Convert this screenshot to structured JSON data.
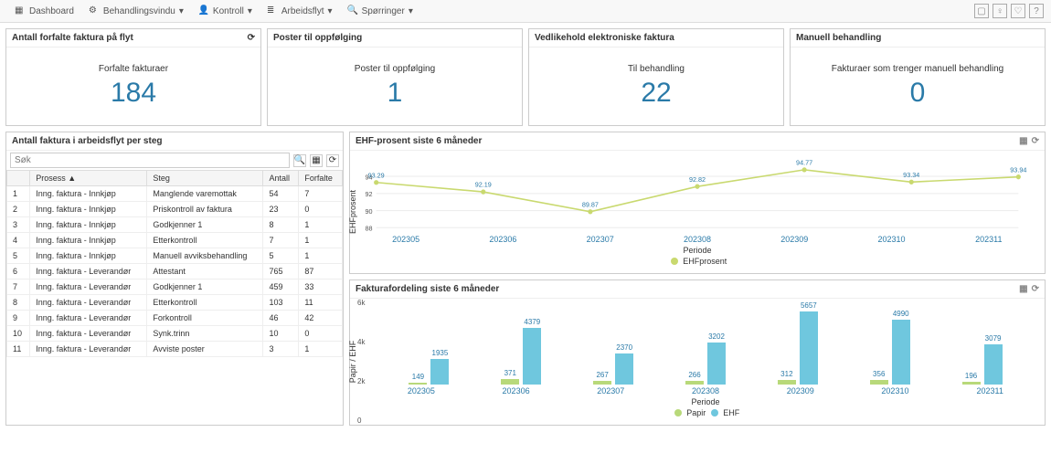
{
  "topbar": {
    "items": [
      {
        "label": "Dashboard",
        "icon": "grid"
      },
      {
        "label": "Behandlingsvindu",
        "icon": "gear",
        "dropdown": true
      },
      {
        "label": "Kontroll",
        "icon": "user",
        "dropdown": true
      },
      {
        "label": "Arbeidsflyt",
        "icon": "flow",
        "dropdown": true
      },
      {
        "label": "Spørringer",
        "icon": "search",
        "dropdown": true
      }
    ]
  },
  "kpis": [
    {
      "title": "Antall forfalte faktura på flyt",
      "label": "Forfalte fakturaer",
      "value": "184",
      "refresh": true
    },
    {
      "title": "Poster til oppfølging",
      "label": "Poster til oppfølging",
      "value": "1"
    },
    {
      "title": "Vedlikehold elektroniske faktura",
      "label": "Til behandling",
      "value": "22"
    },
    {
      "title": "Manuell behandling",
      "label": "Fakturaer som trenger manuell behandling",
      "value": "0"
    }
  ],
  "steg_panel": {
    "title": "Antall faktura i arbeidsflyt per steg",
    "search_placeholder": "Søk",
    "columns": [
      "",
      "Prosess",
      "Steg",
      "Antall",
      "Forfalte"
    ],
    "sort_indicator": "▲",
    "rows": [
      {
        "n": "1",
        "prosess": "Inng. faktura - Innkjøp",
        "steg": "Manglende varemottak",
        "antall": "54",
        "forfalte": "7"
      },
      {
        "n": "2",
        "prosess": "Inng. faktura - Innkjøp",
        "steg": "Priskontroll av faktura",
        "antall": "23",
        "forfalte": "0"
      },
      {
        "n": "3",
        "prosess": "Inng. faktura - Innkjøp",
        "steg": "Godkjenner 1",
        "antall": "8",
        "forfalte": "1"
      },
      {
        "n": "4",
        "prosess": "Inng. faktura - Innkjøp",
        "steg": "Etterkontroll",
        "antall": "7",
        "forfalte": "1"
      },
      {
        "n": "5",
        "prosess": "Inng. faktura - Innkjøp",
        "steg": "Manuell avviksbehandling",
        "antall": "5",
        "forfalte": "1"
      },
      {
        "n": "6",
        "prosess": "Inng. faktura - Leverandør",
        "steg": "Attestant",
        "antall": "765",
        "forfalte": "87"
      },
      {
        "n": "7",
        "prosess": "Inng. faktura - Leverandør",
        "steg": "Godkjenner 1",
        "antall": "459",
        "forfalte": "33"
      },
      {
        "n": "8",
        "prosess": "Inng. faktura - Leverandør",
        "steg": "Etterkontroll",
        "antall": "103",
        "forfalte": "11"
      },
      {
        "n": "9",
        "prosess": "Inng. faktura - Leverandør",
        "steg": "Forkontroll",
        "antall": "46",
        "forfalte": "42"
      },
      {
        "n": "10",
        "prosess": "Inng. faktura - Leverandør",
        "steg": "Synk.trinn",
        "antall": "10",
        "forfalte": "0"
      },
      {
        "n": "11",
        "prosess": "Inng. faktura - Leverandør",
        "steg": "Avviste poster",
        "antall": "3",
        "forfalte": "1"
      }
    ]
  },
  "ehf_panel": {
    "title": "EHF-prosent siste 6 måneder",
    "ylabel": "EHFprosent",
    "xlabel": "Periode",
    "legend": "EHFprosent"
  },
  "faktura_panel": {
    "title": "Fakturafordeling siste 6 måneder",
    "ylabel": "Papir / EHF",
    "xlabel": "Periode",
    "legend_papir": "Papir",
    "legend_ehf": "EHF"
  },
  "chart_data": [
    {
      "id": "ehf_line",
      "type": "line",
      "title": "EHF-prosent siste 6 måneder",
      "xlabel": "Periode",
      "ylabel": "EHFprosent",
      "ylim": [
        88,
        96
      ],
      "categories": [
        "202305",
        "202306",
        "202307",
        "202308",
        "202309",
        "202310",
        "202311"
      ],
      "series": [
        {
          "name": "EHFprosent",
          "values": [
            93.29,
            92.19,
            89.87,
            92.82,
            94.77,
            93.34,
            93.94
          ]
        }
      ],
      "color": "#c9d96f"
    },
    {
      "id": "faktura_bar",
      "type": "bar",
      "title": "Fakturafordeling siste 6 måneder",
      "xlabel": "Periode",
      "ylabel": "Papir / EHF",
      "ylim": [
        0,
        6000
      ],
      "categories": [
        "202305",
        "202306",
        "202307",
        "202308",
        "202309",
        "202310",
        "202311"
      ],
      "series": [
        {
          "name": "Papir",
          "values": [
            149,
            371,
            267,
            266,
            312,
            356,
            196
          ],
          "color": "#b8d97a"
        },
        {
          "name": "EHF",
          "values": [
            1935,
            4379,
            2370,
            3202,
            5657,
            4990,
            3079
          ],
          "color": "#6fc7de"
        }
      ],
      "yticks": [
        "6k",
        "4k",
        "2k",
        "0"
      ]
    }
  ]
}
